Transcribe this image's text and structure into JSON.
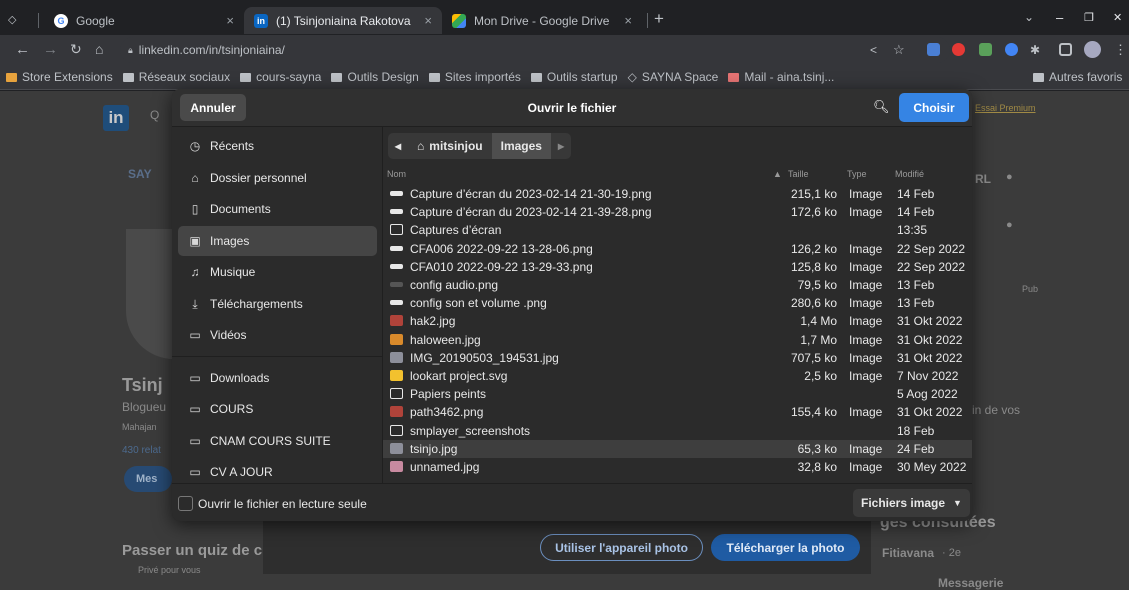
{
  "browser": {
    "tabs": [
      {
        "label": "Google",
        "close": "×"
      },
      {
        "label": "(1) Tsinjoniaina Rakotova",
        "close": "×"
      },
      {
        "label": "Mon Drive - Google Drive",
        "close": "×"
      }
    ],
    "new_tab": "+",
    "url": "linkedin.com/in/tsinjoniaina/",
    "window_controls": [
      "⌄",
      "–",
      "❐",
      "✕"
    ]
  },
  "bookmarks": [
    "Store Extensions",
    "Réseaux sociaux",
    "cours-sayna",
    "Outils Design",
    "Sites importés",
    "Outils startup",
    "SAYNA Space",
    "Mail - aina.tsinj..."
  ],
  "bookmarks_other": "Autres favoris",
  "page": {
    "linkedin_logo": "in",
    "premium_link": "Essai Premium",
    "profile_name": "Tsinj",
    "profile_sub1": "Blogueu",
    "profile_sub2": "Mahajan",
    "profile_sub3": "430 relat",
    "profile_btn": "Mes",
    "url_label": "RL",
    "pub_label": "Pub",
    "news_text": "in de vos",
    "pages_label": "ges consultées",
    "quiz_title": "Passer un quiz de c",
    "quiz_sub": "Privé pour vous",
    "person_name": "Fitiavana",
    "person_degree": "· 2e",
    "messaging": "Messagerie",
    "sayna_label": "SAY"
  },
  "dialog": {
    "title": "Ouvrir le fichier",
    "cancel": "Annuler",
    "choose": "Choisir",
    "sidebar": [
      {
        "label": "Récents",
        "icon": "clock-icon"
      },
      {
        "label": "Dossier personnel",
        "icon": "home-icon"
      },
      {
        "label": "Documents",
        "icon": "document-icon"
      },
      {
        "label": "Images",
        "icon": "image-icon",
        "selected": true
      },
      {
        "label": "Musique",
        "icon": "music-icon"
      },
      {
        "label": "Téléchargements",
        "icon": "download-icon"
      },
      {
        "label": "Vidéos",
        "icon": "video-icon"
      },
      {
        "label": "Downloads",
        "icon": "folder-icon"
      },
      {
        "label": "COURS",
        "icon": "folder-icon"
      },
      {
        "label": "CNAM COURS SUITE",
        "icon": "folder-icon"
      },
      {
        "label": "CV A JOUR",
        "icon": "folder-icon"
      }
    ],
    "path": [
      "mitsinjou",
      "Images"
    ],
    "columns": {
      "name": "Nom",
      "size": "Taille",
      "type": "Type",
      "modified": "Modifié"
    },
    "files": [
      {
        "name": "Capture d’écran du 2023-02-14 21-30-19.png",
        "size": "215,1 ko",
        "type": "Image",
        "modified": "14 Feb",
        "kind": "image"
      },
      {
        "name": "Capture d’écran du 2023-02-14 21-39-28.png",
        "size": "172,6 ko",
        "type": "Image",
        "modified": "14 Feb",
        "kind": "image"
      },
      {
        "name": "Captures d’écran",
        "size": "",
        "type": "",
        "modified": "13:35",
        "kind": "folder"
      },
      {
        "name": "CFA006 2022-09-22 13-28-06.png",
        "size": "126,2 ko",
        "type": "Image",
        "modified": "22 Sep 2022",
        "kind": "image"
      },
      {
        "name": "CFA010 2022-09-22 13-29-33.png",
        "size": "125,8 ko",
        "type": "Image",
        "modified": "22 Sep 2022",
        "kind": "image"
      },
      {
        "name": "config audio.png",
        "size": "79,5 ko",
        "type": "Image",
        "modified": "13 Feb",
        "kind": "image-dark"
      },
      {
        "name": "config son et volume .png",
        "size": "280,6 ko",
        "type": "Image",
        "modified": "13 Feb",
        "kind": "image"
      },
      {
        "name": "hak2.jpg",
        "size": "1,4 Mo",
        "type": "Image",
        "modified": "31 Okt 2022",
        "kind": "photo-red"
      },
      {
        "name": "haloween.jpg",
        "size": "1,7 Mo",
        "type": "Image",
        "modified": "31 Okt 2022",
        "kind": "photo-orange"
      },
      {
        "name": "IMG_20190503_194531.jpg",
        "size": "707,5 ko",
        "type": "Image",
        "modified": "31 Okt 2022",
        "kind": "photo-gray"
      },
      {
        "name": "lookart project.svg",
        "size": "2,5 ko",
        "type": "Image",
        "modified": "7 Nov 2022",
        "kind": "svg"
      },
      {
        "name": "Papiers peints",
        "size": "",
        "type": "",
        "modified": "5 Aog 2022",
        "kind": "folder"
      },
      {
        "name": "path3462.png",
        "size": "155,4 ko",
        "type": "Image",
        "modified": "31 Okt 2022",
        "kind": "photo-red"
      },
      {
        "name": "smplayer_screenshots",
        "size": "",
        "type": "",
        "modified": "18 Feb",
        "kind": "folder"
      },
      {
        "name": "tsinjo.jpg",
        "size": "65,3 ko",
        "type": "Image",
        "modified": "24 Feb",
        "kind": "photo-gray",
        "selected": true
      },
      {
        "name": "unnamed.jpg",
        "size": "32,8 ko",
        "type": "Image",
        "modified": "30 Mey 2022",
        "kind": "photo-pink"
      }
    ],
    "readonly_label": "Ouvrir le fichier en lecture seule",
    "filter": "Fichiers image"
  },
  "upload": {
    "camera": "Utiliser l'appareil photo",
    "upload": "Télécharger la photo"
  }
}
